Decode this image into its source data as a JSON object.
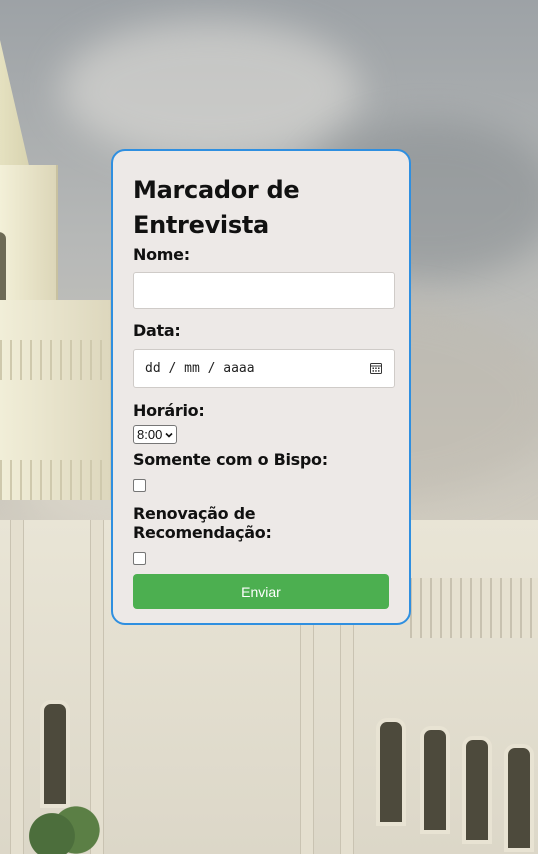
{
  "form": {
    "title": "Marcador de Entrevista",
    "name_label": "Nome:",
    "name_value": "",
    "date_label": "Data:",
    "date_placeholder": "dd / mm / aaaa",
    "time_label": "Horário:",
    "time_selected": "8:00",
    "bishop_label": "Somente com o Bispo:",
    "bishop_checked": false,
    "recommend_label": "Renovação de Recomendação:",
    "recommend_checked": false,
    "submit_label": "Enviar"
  },
  "colors": {
    "card_background": "#ede9e7",
    "card_border": "#2f8fe0",
    "submit_button": "#4caf50"
  },
  "icons": {
    "date_picker": "calendar-icon",
    "select": "chevron-down-icon"
  }
}
